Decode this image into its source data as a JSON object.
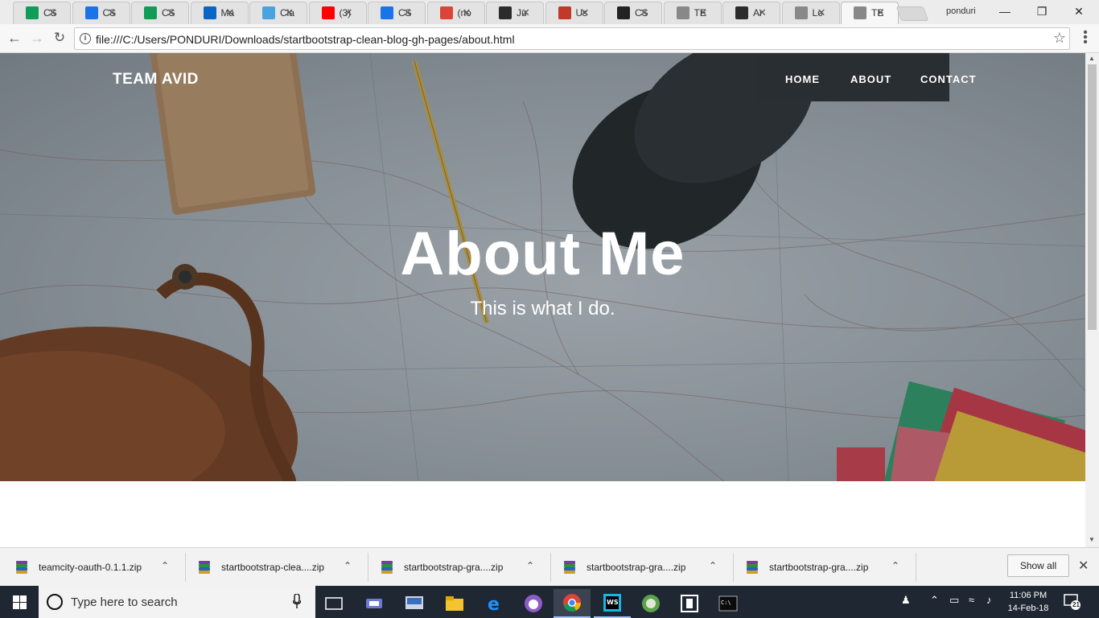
{
  "browser": {
    "tabs": [
      {
        "label": "CS",
        "favicon": "sheets-icon",
        "color": "#0f9d58"
      },
      {
        "label": "CS",
        "favicon": "box-icon",
        "color": "#1a73e8"
      },
      {
        "label": "CS",
        "favicon": "sheets-icon",
        "color": "#0f9d58"
      },
      {
        "label": "Ma",
        "favicon": "linkedin-icon",
        "color": "#0a66c2"
      },
      {
        "label": "Cla",
        "favicon": "ai-icon",
        "color": "#4aa3df"
      },
      {
        "label": "(3)",
        "favicon": "youtube-icon",
        "color": "#ff0000"
      },
      {
        "label": "CS",
        "favicon": "box-icon",
        "color": "#1a73e8"
      },
      {
        "label": "(no",
        "favicon": "gmail-icon",
        "color": "#db4437"
      },
      {
        "label": "Ju",
        "favicon": "webstorm-icon",
        "color": "#2b2b2b"
      },
      {
        "label": "Us",
        "favicon": "eye-icon",
        "color": "#c0392b"
      },
      {
        "label": "CS",
        "favicon": "github-icon",
        "color": "#222222"
      },
      {
        "label": "TE",
        "favicon": "page-icon",
        "color": "#888888"
      },
      {
        "label": "Ar",
        "favicon": "webstorm-icon",
        "color": "#2b2b2b"
      },
      {
        "label": "Lo",
        "favicon": "page-icon",
        "color": "#888888"
      },
      {
        "label": "TE",
        "favicon": "page-icon",
        "color": "#888888"
      }
    ],
    "active_tab_index": 14,
    "profile_name": "ponduri",
    "address": "file:///C:/Users/PONDURI/Downloads/startbootstrap-clean-blog-gh-pages/about.html"
  },
  "page": {
    "brand": "TEAM AVID",
    "nav": [
      "HOME",
      "ABOUT",
      "CONTACT"
    ],
    "heading": "About Me",
    "subheading": "This is what I do."
  },
  "downloads": {
    "items": [
      "teamcity-oauth-0.1.1.zip",
      "startbootstrap-clea....zip",
      "startbootstrap-gra....zip",
      "startbootstrap-gra....zip",
      "startbootstrap-gra....zip"
    ],
    "show_all_label": "Show all"
  },
  "taskbar": {
    "search_placeholder": "Type here to search",
    "time": "11:06 PM",
    "date": "14-Feb-18",
    "notification_count": "21"
  }
}
